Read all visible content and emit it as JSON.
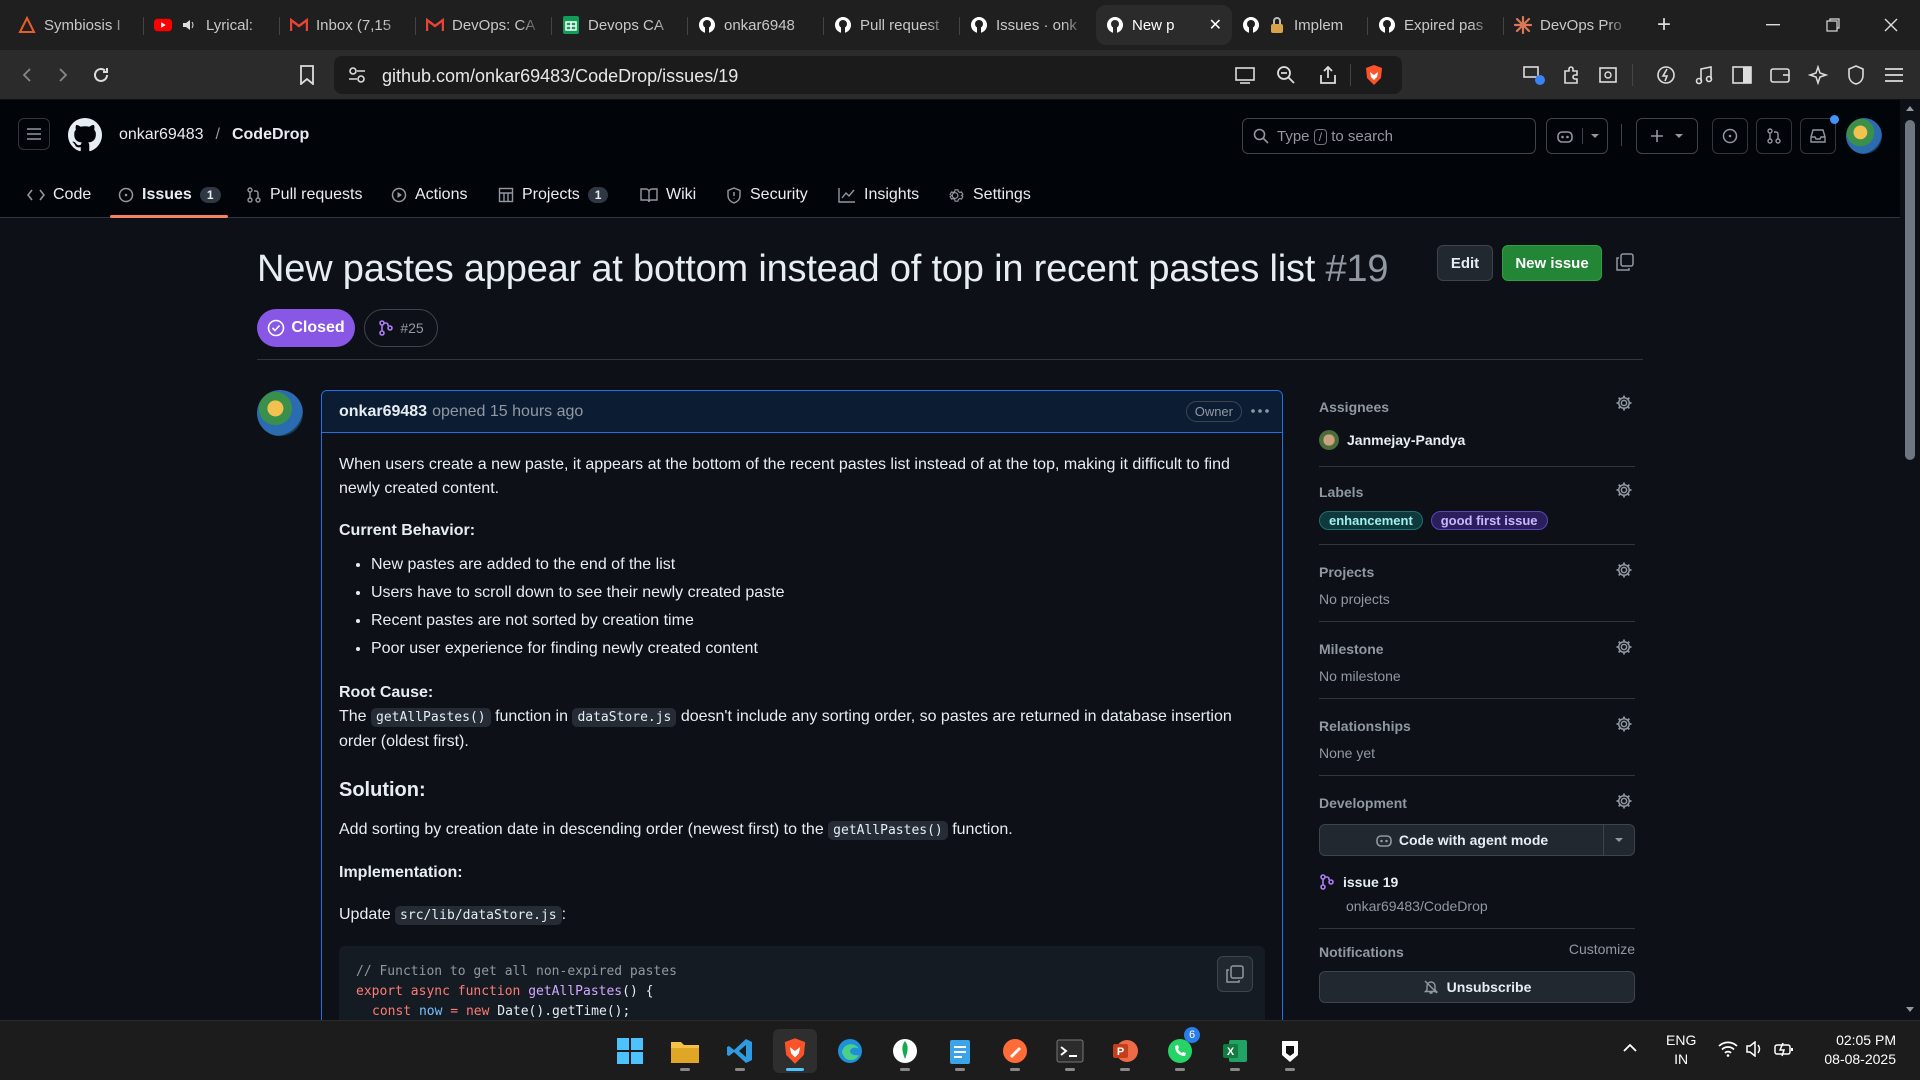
{
  "browser": {
    "tabs": [
      {
        "title": "Symbiosis I",
        "icon": "symbiosis-icon"
      },
      {
        "title": "Lyrical:",
        "icon": "youtube-icon"
      },
      {
        "title": "Inbox (7,15",
        "icon": "gmail-icon"
      },
      {
        "title": "DevOps: CA",
        "icon": "gmail-icon"
      },
      {
        "title": "Devops CA",
        "icon": "sheets-icon"
      },
      {
        "title": "onkar6948",
        "icon": "github-icon"
      },
      {
        "title": "Pull request",
        "icon": "github-icon"
      },
      {
        "title": "Issues · onk",
        "icon": "github-icon"
      },
      {
        "title": "New p",
        "icon": "github-icon",
        "active": true
      },
      {
        "title": "Implem",
        "icon": "github-icon"
      },
      {
        "title": "Expired pas",
        "icon": "github-icon"
      },
      {
        "title": "DevOps Pro",
        "icon": "claude-icon"
      }
    ],
    "url": "github.com/onkar69483/CodeDrop/issues/19"
  },
  "header": {
    "owner": "onkar69483",
    "separator": "/",
    "repo": "CodeDrop",
    "search_placeholder_pre": "Type",
    "search_key": "/",
    "search_placeholder_post": "to search"
  },
  "repo_nav": [
    {
      "label": "Code",
      "icon": "code-icon"
    },
    {
      "label": "Issues",
      "icon": "issue-icon",
      "count": "1",
      "selected": true
    },
    {
      "label": "Pull requests",
      "icon": "pull-request-icon"
    },
    {
      "label": "Actions",
      "icon": "play-icon"
    },
    {
      "label": "Projects",
      "icon": "table-icon",
      "count": "1"
    },
    {
      "label": "Wiki",
      "icon": "book-icon"
    },
    {
      "label": "Security",
      "icon": "shield-icon"
    },
    {
      "label": "Insights",
      "icon": "graph-icon"
    },
    {
      "label": "Settings",
      "icon": "gear-icon"
    }
  ],
  "issue": {
    "title": "New pastes appear at bottom instead of top in recent pastes list",
    "number": "#19",
    "status": "Closed",
    "linked_pr": "#25",
    "edit_label": "Edit",
    "new_issue_label": "New issue"
  },
  "comment": {
    "author": "onkar69483",
    "meta": "opened 15 hours ago",
    "role": "Owner",
    "intro": "When users create a new paste, it appears at the bottom of the recent pastes list instead of at the top, making it difficult to find newly created content.",
    "current_behavior_heading": "Current Behavior:",
    "current_behavior": [
      "New pastes are added to the end of the list",
      "Users have to scroll down to see their newly created paste",
      "Recent pastes are not sorted by creation time",
      "Poor user experience for finding newly created content"
    ],
    "root_cause_heading": "Root Cause:",
    "root_cause_the": "The",
    "root_cause_fn": "getAllPastes()",
    "root_cause_in": "function in",
    "root_cause_file": "dataStore.js",
    "root_cause_rest": "doesn't include any sorting order, so pastes are returned in database insertion order (oldest first).",
    "solution_heading": "Solution:",
    "solution_pre": "Add sorting by creation date in descending order (newest first) to the",
    "solution_fn": "getAllPastes()",
    "solution_post": "function.",
    "implementation_heading": "Implementation:",
    "update_label": "Update",
    "update_file": "src/lib/dataStore.js",
    "update_colon": ":",
    "code_comment": "// Function to get all non-expired pastes",
    "code_line2_kw": "export async function",
    "code_line2_fn": "getAllPastes",
    "code_line2_rest": "() {",
    "code_line3_kw": "const",
    "code_line3_var": "now",
    "code_line3_eq": "=",
    "code_line3_new": "new",
    "code_line3_rest": "Date().getTime();"
  },
  "sidebar": {
    "assignees_heading": "Assignees",
    "assignee": "Janmejay-Pandya",
    "labels_heading": "Labels",
    "labels": [
      {
        "name": "enhancement",
        "bg": "#0e3a3e",
        "fg": "#a2eeef",
        "border": "#1f6f74"
      },
      {
        "name": "good first issue",
        "bg": "#2a1f5c",
        "fg": "#c8b6ff",
        "border": "#5b46b8"
      }
    ],
    "projects_heading": "Projects",
    "projects_value": "No projects",
    "milestone_heading": "Milestone",
    "milestone_value": "No milestone",
    "relationships_heading": "Relationships",
    "relationships_value": "None yet",
    "development_heading": "Development",
    "agent_button": "Code with agent mode",
    "branch_name": "issue 19",
    "branch_repo": "onkar69483/CodeDrop",
    "notifications_heading": "Notifications",
    "customize_label": "Customize",
    "unsubscribe_label": "Unsubscribe"
  },
  "taskbar": {
    "lang_line1": "ENG",
    "lang_line2": "IN",
    "time": "02:05 PM",
    "date": "08-08-2025",
    "whatsapp_badge": "6"
  },
  "colors": {
    "accent_green": "#238636",
    "closed_purple": "#8957e5",
    "nav_underline": "#f78166"
  }
}
